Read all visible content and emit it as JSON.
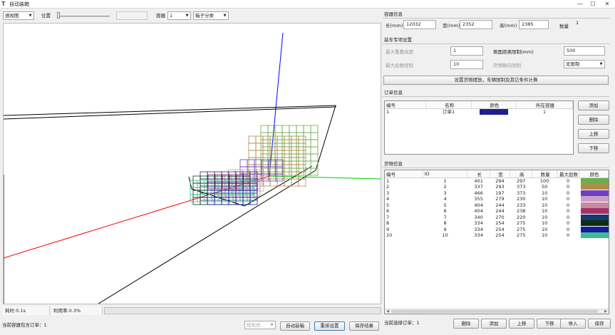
{
  "window": {
    "title": "自动装箱",
    "app_icon": "T",
    "controls": [
      "—",
      "☐",
      "✕"
    ]
  },
  "toolbar": {
    "view_mode": "透视图",
    "position_label": "位置",
    "container_label": "容器",
    "container_value": "1",
    "group_mode": "箱子分类"
  },
  "status": {
    "time": "耗时:0.1s",
    "utilization": "利用率:0.3%",
    "current_container_orders": "当前容器包含订单：1"
  },
  "bottom_controls": {
    "mode_select": "优化式",
    "auto_pack_button": "自动装箱",
    "manual_settings_button": "重排设置",
    "save_result_button": "保存结果"
  },
  "container_info": {
    "title": "容器信息",
    "length_label": "长(mm)",
    "length_value": "12032",
    "width_label": "宽(mm)",
    "width_value": "2352",
    "height_label": "高(mm)",
    "height_value": "2385",
    "qty_label": "数量",
    "qty_value": "1"
  },
  "packing_settings": {
    "title": "装车专项设置",
    "max_stack_label": "最大重叠高度",
    "max_stack_value": "1",
    "gap_label": "侧面距离限制(mm)",
    "gap_value": "500",
    "max_layers_label": "最大层数限制",
    "max_layers_value": "10",
    "orientation_label": "货物朝向限制",
    "orientation_value": "无限制",
    "apply_button": "设置货物摆放，车辆限制及其它条件计算"
  },
  "orders": {
    "title": "订单信息",
    "columns": [
      "编号",
      "名称",
      "颜色",
      "所在容器"
    ],
    "rows": [
      {
        "id": "1",
        "name": "订单1",
        "color": "#1f1f8f",
        "container": "1"
      }
    ],
    "buttons": [
      "添加",
      "删除",
      "上移",
      "下移"
    ]
  },
  "goods": {
    "title": "货物信息",
    "columns": [
      "编号",
      "ID",
      "长",
      "宽",
      "高",
      "数量",
      "最大层数",
      "颜色"
    ],
    "rows": [
      {
        "no": "1",
        "id": "1",
        "l": "401",
        "w": "294",
        "h": "297",
        "qty": "100",
        "layers": "0",
        "color": "#6bae4f"
      },
      {
        "no": "2",
        "id": "2",
        "l": "337",
        "w": "293",
        "h": "373",
        "qty": "50",
        "layers": "0",
        "color": "#b08c4a"
      },
      {
        "no": "3",
        "id": "3",
        "l": "466",
        "w": "197",
        "h": "373",
        "qty": "10",
        "layers": "0",
        "color": "#6e3fc2"
      },
      {
        "no": "4",
        "id": "4",
        "l": "355",
        "w": "279",
        "h": "230",
        "qty": "10",
        "layers": "0",
        "color": "#c9a0c9"
      },
      {
        "no": "5",
        "id": "5",
        "l": "404",
        "w": "244",
        "h": "233",
        "qty": "10",
        "layers": "0",
        "color": "#c68aa0"
      },
      {
        "no": "6",
        "id": "6",
        "l": "404",
        "w": "244",
        "h": "238",
        "qty": "10",
        "layers": "0",
        "color": "#a8306a"
      },
      {
        "no": "7",
        "id": "7",
        "l": "340",
        "w": "270",
        "h": "220",
        "qty": "10",
        "layers": "0",
        "color": "#163a6b"
      },
      {
        "no": "8",
        "id": "8",
        "l": "334",
        "w": "254",
        "h": "275",
        "qty": "10",
        "layers": "0",
        "color": "#0e2e14"
      },
      {
        "no": "9",
        "id": "9",
        "l": "334",
        "w": "254",
        "h": "275",
        "qty": "10",
        "layers": "0",
        "color": "#1a1aa0"
      },
      {
        "no": "10",
        "id": "10",
        "l": "334",
        "w": "254",
        "h": "275",
        "qty": "10",
        "layers": "0",
        "color": "#3cbc92"
      }
    ],
    "current_order": "当前选择订单：1",
    "buttons": [
      "删除",
      "添加",
      "上移",
      "下移",
      "导入",
      "保存"
    ]
  }
}
